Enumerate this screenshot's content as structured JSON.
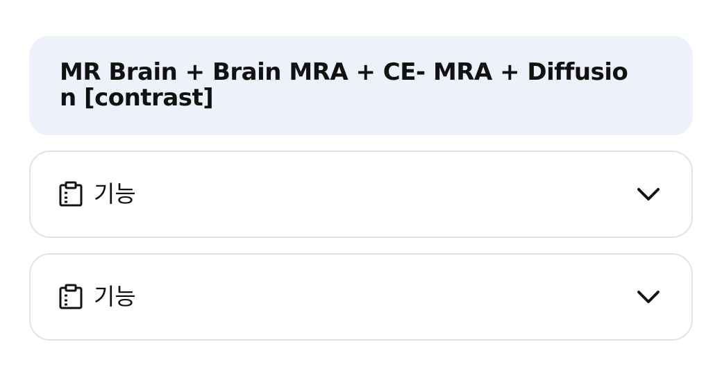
{
  "header": {
    "title": "MR Brain + Brain MRA + CE- MRA + Diffusion [contrast]"
  },
  "sections": [
    {
      "icon": "clipboard-icon",
      "label": "기능",
      "expanded": false
    },
    {
      "icon": "clipboard-icon",
      "label": "기능",
      "expanded": false
    }
  ]
}
